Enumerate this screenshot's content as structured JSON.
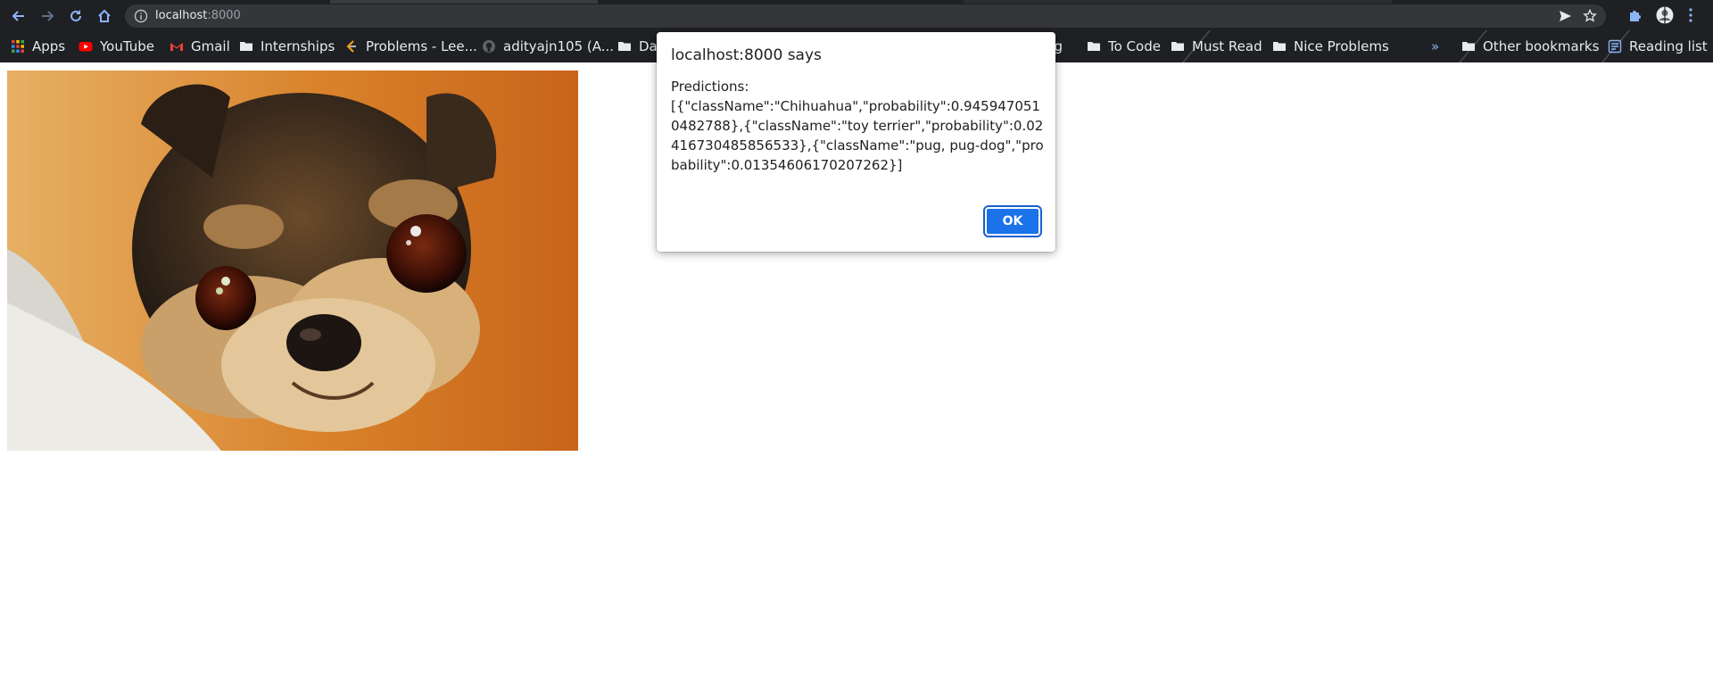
{
  "browser": {
    "url_host": "localhost",
    "url_port": ":8000",
    "bookmarks": [
      {
        "label": "Apps",
        "icon": "apps-grid-icon"
      },
      {
        "label": "YouTube",
        "icon": "youtube-icon"
      },
      {
        "label": "Gmail",
        "icon": "gmail-icon"
      },
      {
        "label": "Internships",
        "icon": "folder-icon"
      },
      {
        "label": "Problems - Lee...",
        "icon": "leetcode-icon"
      },
      {
        "label": "adityajn105 (A...",
        "icon": "github-icon"
      },
      {
        "label": "Da",
        "icon": "folder-icon"
      },
      {
        "label": "ng",
        "icon": "folder-icon"
      },
      {
        "label": "To Code",
        "icon": "folder-icon"
      },
      {
        "label": "Must Read",
        "icon": "folder-icon"
      },
      {
        "label": "Nice Problems",
        "icon": "folder-icon"
      },
      {
        "label": "Other bookmarks",
        "icon": "folder-icon"
      },
      {
        "label": "Reading list",
        "icon": "reading-list-icon"
      }
    ],
    "overflow_label": "»"
  },
  "dialog": {
    "title": "localhost:8000 says",
    "message": "Predictions:\n[{\"className\":\"Chihuahua\",\"probability\":0.9459470510482788},{\"className\":\"toy terrier\",\"probability\":0.02416730485856533},{\"className\":\"pug, pug-dog\",\"probability\":0.01354606170207262}]",
    "ok_label": "OK"
  },
  "colors": {
    "chrome_bg": "#1f2023",
    "omnibox_bg": "#35363a",
    "accent_blue": "#1a73e8"
  }
}
